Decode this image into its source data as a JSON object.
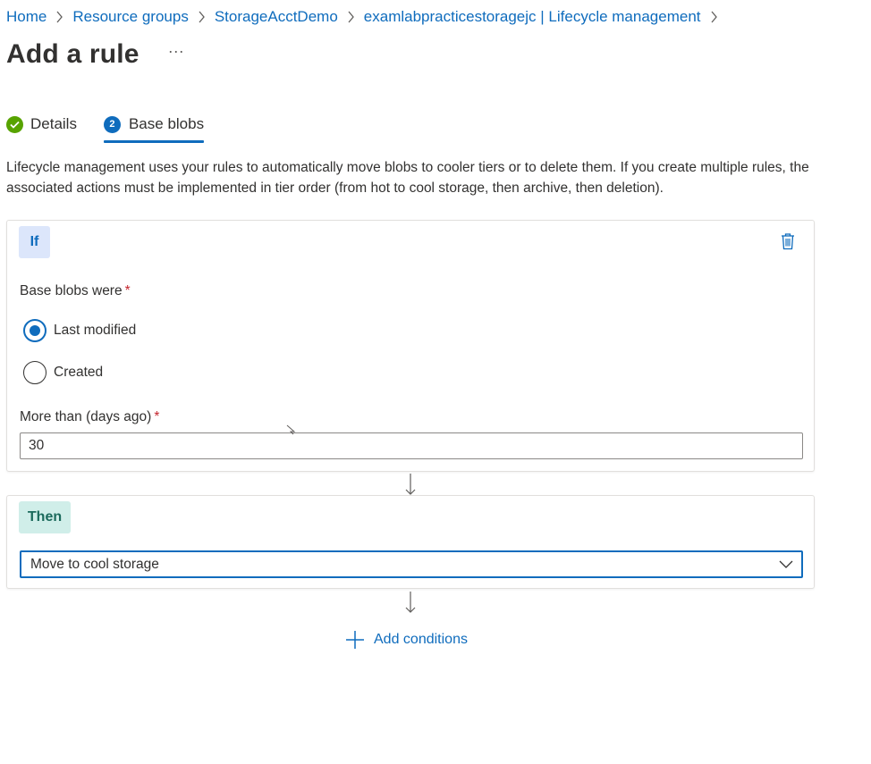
{
  "breadcrumb": {
    "items": [
      {
        "label": "Home"
      },
      {
        "label": "Resource groups"
      },
      {
        "label": "StorageAcctDemo"
      },
      {
        "label": "examlabpracticestoragejc | Lifecycle management"
      }
    ]
  },
  "header": {
    "title": "Add a rule",
    "more_label": "···"
  },
  "tabs": [
    {
      "label": "Details",
      "state": "completed",
      "icon": "check-circle-icon"
    },
    {
      "label": "Base blobs",
      "state": "active",
      "step": "2"
    }
  ],
  "description": "Lifecycle management uses your rules to automatically move blobs to cooler tiers or to delete them. If you create multiple rules, the associated actions must be implemented in tier order (from hot to cool storage, then archive, then deletion).",
  "if_block": {
    "badge": "If",
    "delete_icon": "trash-icon",
    "base_blobs_label": "Base blobs were",
    "required_mark": "*",
    "options": [
      {
        "label": "Last modified",
        "checked": true
      },
      {
        "label": "Created",
        "checked": false
      }
    ],
    "days_label": "More than (days ago)",
    "days_value": "30"
  },
  "then_block": {
    "badge": "Then",
    "selected_action": "Move to cool storage",
    "dropdown_icon": "chevron-down-icon"
  },
  "add_conditions": {
    "label": "Add conditions",
    "icon": "plus-icon"
  },
  "colors": {
    "accent": "#0f6cbd",
    "success": "#57a300",
    "required": "#c4262e",
    "if_badge_bg": "#dce6fb",
    "then_badge_bg": "#d0eee9"
  }
}
